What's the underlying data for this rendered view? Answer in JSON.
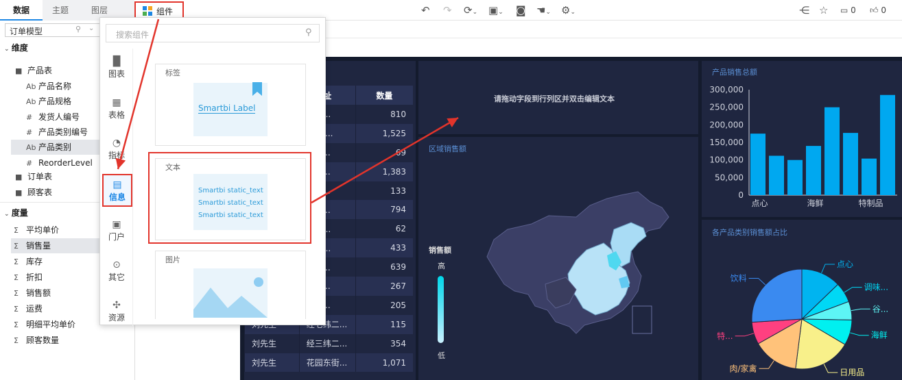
{
  "topbar": {
    "tabs": [
      "数据",
      "主题",
      "图层"
    ],
    "component_label": "组件",
    "comment_count": "0",
    "like_count": "0"
  },
  "left": {
    "model_select": "订单模型",
    "dimension_header": "维度",
    "product_table": "产品表",
    "product_fields": [
      {
        "icon": "Ab",
        "name": "产品名称"
      },
      {
        "icon": "Ab",
        "name": "产品规格"
      },
      {
        "icon": "#",
        "name": "发货人编号"
      },
      {
        "icon": "#",
        "name": "产品类别编号"
      },
      {
        "icon": "Ab",
        "name": "产品类别"
      },
      {
        "icon": "#",
        "name": "ReorderLevel"
      }
    ],
    "order_table": "订单表",
    "customer_table": "顾客表",
    "measure_header": "度量",
    "measures": [
      "平均单价",
      "销售量",
      "库存",
      "折扣",
      "销售额",
      "运费",
      "明细平均单价",
      "顾客数量"
    ]
  },
  "popup": {
    "search_placeholder": "搜索组件",
    "categories": [
      "图表",
      "表格",
      "指标",
      "信息",
      "门户",
      "其它",
      "资源"
    ],
    "cards": {
      "label_title": "标签",
      "label_sample": "Smartbi Label",
      "text_title": "文本",
      "text_lines": [
        "Smartbi static_text",
        "Smartbi static_text",
        "Smartbi static_text"
      ],
      "image_title": "图片"
    }
  },
  "dashboard": {
    "table": {
      "headers": [
        "址",
        "数量"
      ],
      "rows": [
        [
          "",
          "口街...",
          "810"
        ],
        [
          "",
          "路 9 ...",
          "1,525"
        ],
        [
          "",
          "街 4...",
          "69"
        ],
        [
          "",
          "路 6...",
          "1,383"
        ],
        [
          "",
          "路 3...",
          "133"
        ],
        [
          "",
          "路 8...",
          "794"
        ],
        [
          "",
          "西路...",
          "62"
        ],
        [
          "",
          "大街...",
          "433"
        ],
        [
          "",
          "路 2...",
          "639"
        ],
        [
          "",
          "街 4...",
          "267"
        ],
        [
          "",
          "路 4...",
          "205"
        ],
        [
          "刘先生",
          "经七纬二...",
          "115"
        ],
        [
          "刘先生",
          "经三纬二...",
          "354"
        ],
        [
          "刘先生",
          "花园东街...",
          "1,071"
        ]
      ]
    },
    "text_hint": "请拖动字段到行列区并双击编辑文本",
    "map": {
      "title": "区域销售额",
      "legend_title": "销售额",
      "legend_high": "高",
      "legend_low": "低"
    },
    "colors": {
      "bar": "#00a8f0",
      "background": "#141b2d",
      "panel": "#1f2640"
    }
  },
  "chart_data": [
    {
      "type": "bar",
      "title": "产品销售总额",
      "categories": [
        "点心",
        "",
        "",
        "海鲜",
        "",
        "",
        "特制品",
        ""
      ],
      "tick_labels": [
        "点心",
        "海鲜",
        "特制品"
      ],
      "values": [
        175000,
        112000,
        100000,
        140000,
        250000,
        177000,
        104000,
        285000
      ],
      "ylim": [
        0,
        300000
      ],
      "yticks": [
        "0",
        "50,000",
        "100,000",
        "150,000",
        "200,000",
        "250,000",
        "300,000"
      ]
    },
    {
      "type": "pie",
      "title": "各产品类别销售额占比",
      "slices": [
        {
          "name": "点心",
          "value": 12.8,
          "color": "#00b4f0"
        },
        {
          "name": "调味...",
          "value": 6.5,
          "color": "#00d8f5"
        },
        {
          "name": "谷...",
          "value": 6.0,
          "color": "#5df5f5"
        },
        {
          "name": "海鲜",
          "value": 8.2,
          "color": "#00f0f0"
        },
        {
          "name": "日用品",
          "value": 18.5,
          "color": "#f8f08a"
        },
        {
          "name": "肉/家禽",
          "value": 14.8,
          "color": "#ffc27a"
        },
        {
          "name": "特...",
          "value": 7.2,
          "color": "#ff4080"
        },
        {
          "name": "饮料",
          "value": 26.0,
          "color": "#3a8af0"
        }
      ]
    }
  ]
}
